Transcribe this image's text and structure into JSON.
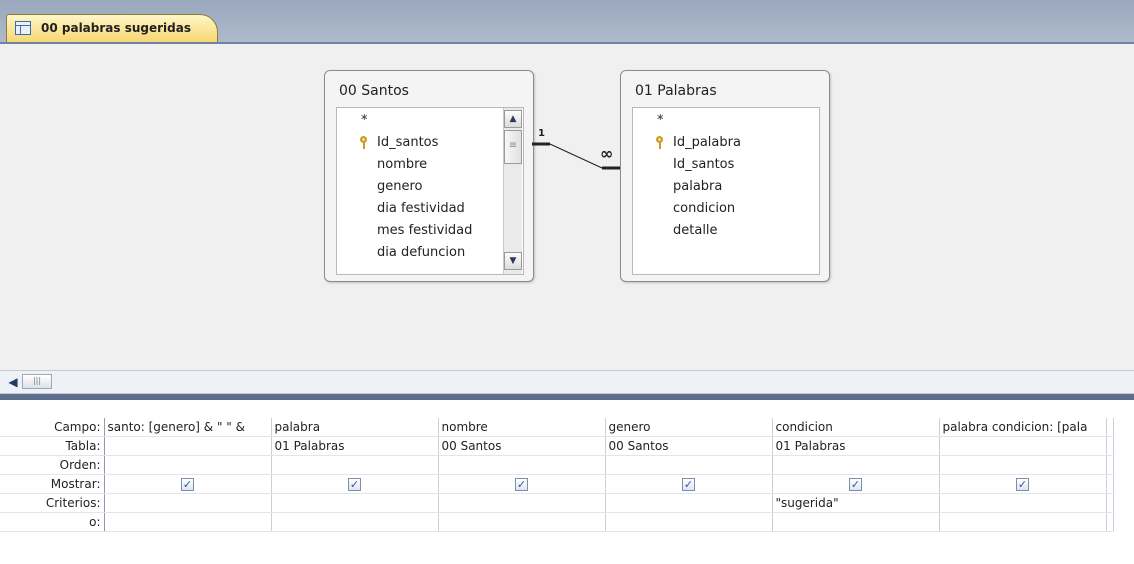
{
  "tab": {
    "label": "00 palabras sugeridas"
  },
  "tables": [
    {
      "title": "00 Santos",
      "fields": [
        "*",
        "Id_santos",
        "nombre",
        "genero",
        "dia festividad",
        "mes festividad",
        "dia defuncion"
      ],
      "key_field_index": 1
    },
    {
      "title": "01 Palabras",
      "fields": [
        "*",
        "Id_palabra",
        "Id_santos",
        "palabra",
        "condicion",
        "detalle"
      ],
      "key_field_index": 1
    }
  ],
  "relationship": {
    "one_label": "1",
    "many_label": "∞"
  },
  "grid": {
    "row_headers": [
      "Campo:",
      "Tabla:",
      "Orden:",
      "Mostrar:",
      "Criterios:",
      "o:"
    ],
    "columns": [
      {
        "campo": "santo: [genero] & \" \" &",
        "tabla": "",
        "orden": "",
        "mostrar": true,
        "criterios": "",
        "o": ""
      },
      {
        "campo": "palabra",
        "tabla": "01 Palabras",
        "orden": "",
        "mostrar": true,
        "criterios": "",
        "o": ""
      },
      {
        "campo": "nombre",
        "tabla": "00 Santos",
        "orden": "",
        "mostrar": true,
        "criterios": "",
        "o": ""
      },
      {
        "campo": "genero",
        "tabla": "00 Santos",
        "orden": "",
        "mostrar": true,
        "criterios": "",
        "o": ""
      },
      {
        "campo": "condicion",
        "tabla": "01 Palabras",
        "orden": "",
        "mostrar": true,
        "criterios": "\"sugerida\"",
        "o": ""
      },
      {
        "campo": "palabra condicion: [pala",
        "tabla": "",
        "orden": "",
        "mostrar": true,
        "criterios": "",
        "o": ""
      }
    ]
  }
}
